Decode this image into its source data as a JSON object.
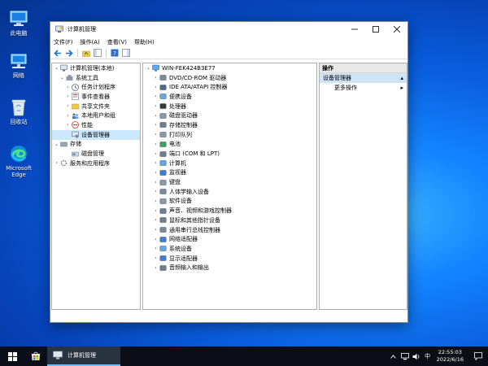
{
  "desktop": {
    "icons": [
      {
        "label": "此电脑",
        "icon": "this-pc-icon"
      },
      {
        "label": "网络",
        "icon": "network-icon"
      },
      {
        "label": "回收站",
        "icon": "recycle-bin-icon"
      },
      {
        "label": "Microsoft Edge",
        "icon": "edge-icon"
      }
    ]
  },
  "window": {
    "title": "计算机管理",
    "menu": [
      "文件(F)",
      "操作(A)",
      "查看(V)",
      "帮助(H)"
    ]
  },
  "tree": {
    "root": "计算机管理(本地)",
    "system_tools": "系统工具",
    "items": [
      "任务计划程序",
      "事件查看器",
      "共享文件夹",
      "本地用户和组",
      "性能",
      "设备管理器"
    ],
    "storage": "存储",
    "disk_mgmt": "磁盘管理",
    "services": "服务和应用程序"
  },
  "devices": {
    "computer": "WIN-FEK424B3E77",
    "list": [
      "DVD/CD-ROM 驱动器",
      "IDE ATA/ATAPI 控制器",
      "便携设备",
      "处理器",
      "磁盘驱动器",
      "存储控制器",
      "打印队列",
      "电池",
      "端口 (COM 和 LPT)",
      "计算机",
      "监视器",
      "键盘",
      "人体学输入设备",
      "软件设备",
      "声音、视频和游戏控制器",
      "鼠标和其他指针设备",
      "通用串行总线控制器",
      "网络适配器",
      "系统设备",
      "显示适配器",
      "音频输入和输出"
    ]
  },
  "actions": {
    "header": "操作",
    "section": "设备管理器",
    "more": "更多操作"
  },
  "taskbar": {
    "app_label": "计算机管理",
    "time": "22:55:03",
    "date": "2022/6/16"
  },
  "colors": {
    "desktop": "#0a5fe0",
    "selection": "#cce8ff",
    "action_section": "#cfe3f6",
    "taskbar": "#0b0e16"
  }
}
